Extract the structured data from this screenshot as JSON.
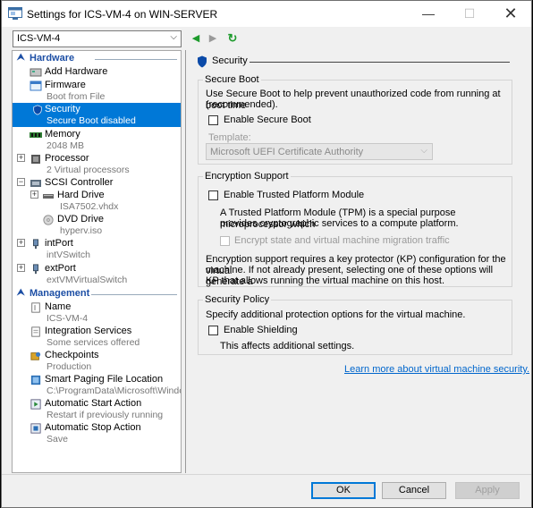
{
  "window": {
    "title": "Settings for ICS-VM-4 on WIN-SERVER",
    "minimize_label": "—",
    "maximize_label": "☐",
    "close_label": "✕"
  },
  "toolbar": {
    "vm_selected": "ICS-VM-4",
    "back_icon": "◀",
    "forward_icon": "▶",
    "refresh_icon": "↻"
  },
  "tree": {
    "hardware_header": "Hardware",
    "management_header": "Management",
    "collapse_symbol": "⮝",
    "hardware": [
      {
        "name": "Add Hardware",
        "sub": ""
      },
      {
        "name": "Firmware",
        "sub": "Boot from File"
      },
      {
        "name": "Security",
        "sub": "Secure Boot disabled"
      },
      {
        "name": "Memory",
        "sub": "2048 MB"
      },
      {
        "name": "Processor",
        "sub": "2 Virtual processors"
      },
      {
        "name": "SCSI Controller",
        "sub": ""
      },
      {
        "name": "Hard Drive",
        "sub": "ISA7502.vhdx"
      },
      {
        "name": "DVD Drive",
        "sub": "hyperv.iso"
      },
      {
        "name": "intPort",
        "sub": "intVSwitch"
      },
      {
        "name": "extPort",
        "sub": "extVMVirtualSwitch"
      }
    ],
    "management": [
      {
        "name": "Name",
        "sub": "ICS-VM-4"
      },
      {
        "name": "Integration Services",
        "sub": "Some services offered"
      },
      {
        "name": "Checkpoints",
        "sub": "Production"
      },
      {
        "name": "Smart Paging File Location",
        "sub": "C:\\ProgramData\\Microsoft\\Windo..."
      },
      {
        "name": "Automatic Start Action",
        "sub": "Restart if previously running"
      },
      {
        "name": "Automatic Stop Action",
        "sub": "Save"
      }
    ]
  },
  "pane": {
    "title": "Security",
    "secure_boot": {
      "group_title": "Secure Boot",
      "description_line1": "Use Secure Boot to help prevent unauthorized code from running at boot time",
      "description_line2": "(recommended).",
      "enable_label": "Enable Secure Boot",
      "template_label": "Template:",
      "template_value": "Microsoft UEFI Certificate Authority"
    },
    "encryption": {
      "group_title": "Encryption Support",
      "tpm_label": "Enable Trusted Platform Module",
      "tpm_desc_line1": "A Trusted Platform Module (TPM) is a special purpose microprocessor which",
      "tpm_desc_line2": "provides cryptographic services to a compute platform.",
      "encrypt_state_label": "Encrypt state and virtual machine migration traffic",
      "kp_line1": "Encryption support requires a key protector (KP) configuration for the virtual",
      "kp_line2": "machine. If not already present, selecting one of these options will generate a",
      "kp_line3": "KP that allows running the virtual machine on this host."
    },
    "policy": {
      "group_title": "Security Policy",
      "description": "Specify additional protection options for the virtual machine.",
      "shielding_label": "Enable Shielding",
      "shielding_note": "This affects additional settings."
    },
    "learn_more": "Learn more about virtual machine security."
  },
  "buttons": {
    "ok": "OK",
    "cancel": "Cancel",
    "apply": "Apply"
  },
  "colors": {
    "selection": "#0078d7",
    "header_blue": "#1d4fa5",
    "link": "#0066cc"
  }
}
